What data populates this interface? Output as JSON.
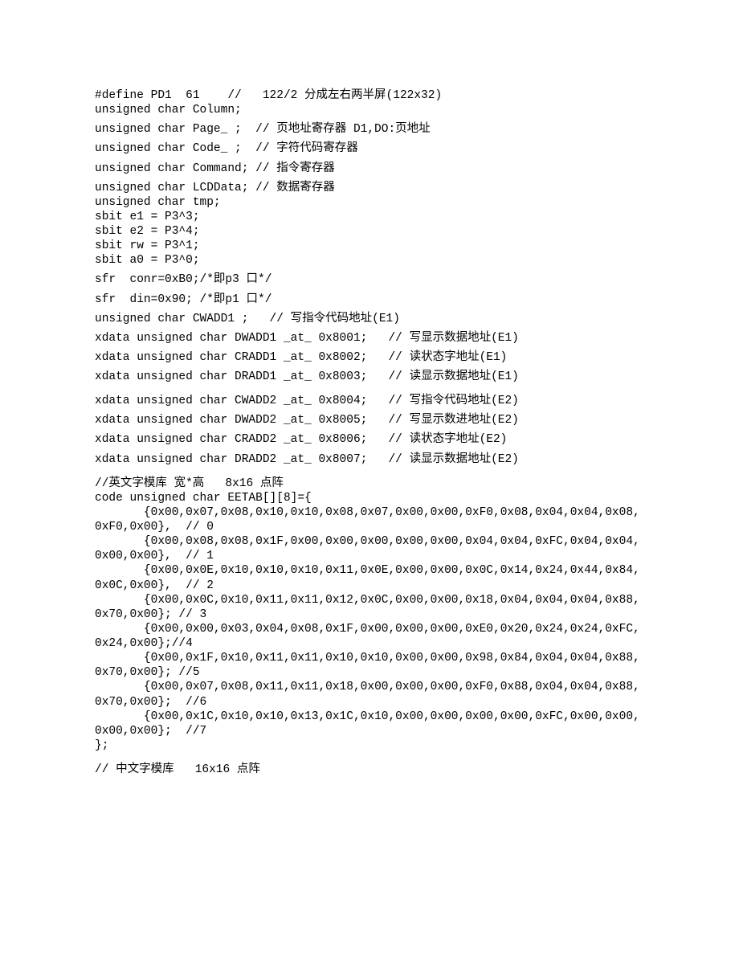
{
  "lines": [
    "#define PD1  61    //   122/2 分成左右两半屏(122x32)",
    "unsigned char Column;",
    "",
    "unsigned char Page_ ;  // 页地址寄存器 D1,DO:页地址",
    "",
    "unsigned char Code_ ;  // 字符代码寄存器",
    "",
    "unsigned char Command; // 指令寄存器",
    "",
    "unsigned char LCDData; // 数据寄存器",
    "unsigned char tmp;",
    "sbit e1 = P3^3;",
    "sbit e2 = P3^4;",
    "sbit rw = P3^1;",
    "sbit a0 = P3^0;",
    "",
    "sfr  conr=0xB0;/*即p3 口*/",
    "",
    "sfr  din=0x90; /*即p1 口*/",
    "",
    "unsigned char CWADD1 ;   // 写指令代码地址(E1)",
    "",
    "xdata unsigned char DWADD1 _at_ 0x8001;   // 写显示数据地址(E1)",
    "",
    "xdata unsigned char CRADD1 _at_ 0x8002;   // 读状态字地址(E1)",
    "",
    "xdata unsigned char DRADD1 _at_ 0x8003;   // 读显示数据地址(E1)",
    "",
    "",
    "xdata unsigned char CWADD2 _at_ 0x8004;   // 写指令代码地址(E2)",
    "",
    "xdata unsigned char DWADD2 _at_ 0x8005;   // 写显示数进地址(E2)",
    "",
    "xdata unsigned char CRADD2 _at_ 0x8006;   // 读状态字地址(E2)",
    "",
    "xdata unsigned char DRADD2 _at_ 0x8007;   // 读显示数据地址(E2)",
    "",
    "",
    "//英文字模库 宽*高   8x16 点阵",
    "code unsigned char EETAB[][8]={",
    "       {0x00,0x07,0x08,0x10,0x10,0x08,0x07,0x00,0x00,0xF0,0x08,0x04,0x04,0x08,0xF0,0x00},  // 0",
    "       {0x00,0x08,0x08,0x1F,0x00,0x00,0x00,0x00,0x00,0x04,0x04,0xFC,0x04,0x04,0x00,0x00},  // 1",
    "       {0x00,0x0E,0x10,0x10,0x10,0x11,0x0E,0x00,0x00,0x0C,0x14,0x24,0x44,0x84,0x0C,0x00},  // 2",
    "       {0x00,0x0C,0x10,0x11,0x11,0x12,0x0C,0x00,0x00,0x18,0x04,0x04,0x04,0x88,0x70,0x00}; // 3",
    "       {0x00,0x00,0x03,0x04,0x08,0x1F,0x00,0x00,0x00,0xE0,0x20,0x24,0x24,0xFC,0x24,0x00};//4",
    "       {0x00,0x1F,0x10,0x11,0x11,0x10,0x10,0x00,0x00,0x98,0x84,0x04,0x04,0x88,0x70,0x00}; //5",
    "       {0x00,0x07,0x08,0x11,0x11,0x18,0x00,0x00,0x00,0xF0,0x88,0x04,0x04,0x88,0x70,0x00};  //6",
    "       {0x00,0x1C,0x10,0x10,0x13,0x1C,0x10,0x00,0x00,0x00,0x00,0xFC,0x00,0x00,0x00,0x00};  //7",
    "};",
    "",
    "",
    "// 中文字模库   16x16 点阵"
  ]
}
